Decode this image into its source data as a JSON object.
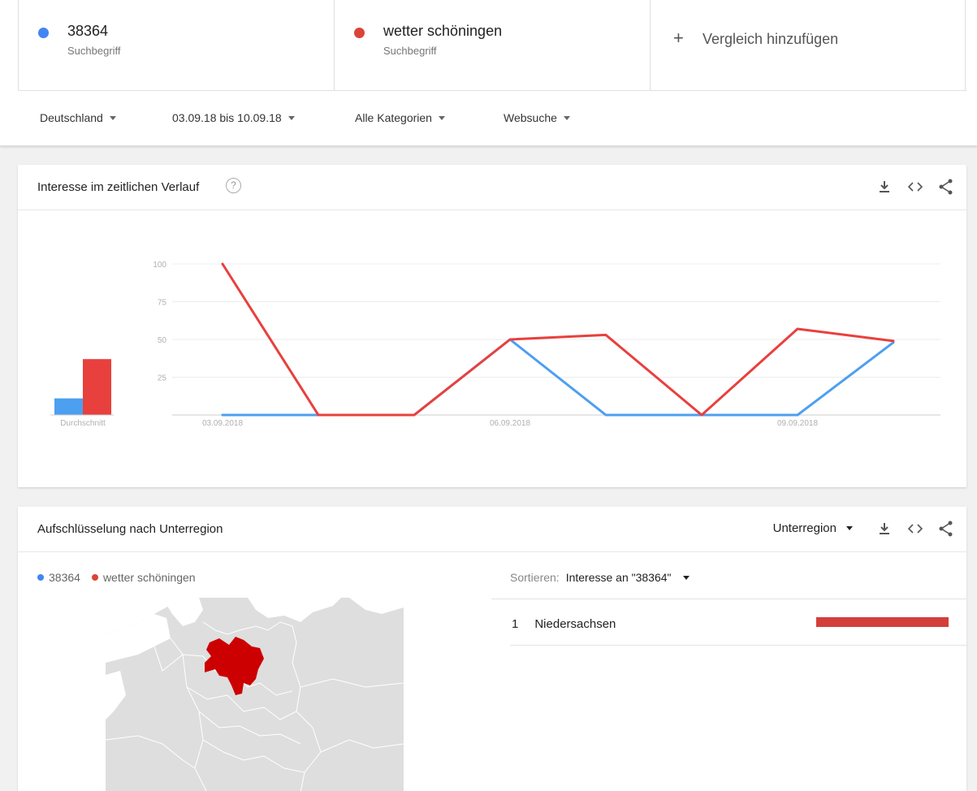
{
  "terms": [
    {
      "name": "38364",
      "type": "Suchbegriff",
      "color": "#4285f4"
    },
    {
      "name": "wetter schöningen",
      "type": "Suchbegriff",
      "color": "#db4437"
    }
  ],
  "add_compare": {
    "label": "Vergleich hinzufügen"
  },
  "filters": {
    "region": "Deutschland",
    "date": "03.09.18 bis 10.09.18",
    "category": "Alle Kategorien",
    "search_type": "Websuche"
  },
  "interest_card": {
    "title": "Interesse im zeitlichen Verlauf",
    "help": "?",
    "average_label": "Durchschnitt"
  },
  "breakdown_card": {
    "title": "Aufschlüsselung nach Unterregion",
    "resolution": "Unterregion",
    "legend": [
      "38364",
      "wetter schöningen"
    ],
    "sort_label": "Sortieren:",
    "sort_value": "Interesse an \"38364\"",
    "rows": [
      {
        "rank": "1",
        "region": "Niedersachsen",
        "value_fraction": 1.0
      }
    ]
  },
  "chart_data": [
    {
      "type": "line",
      "x": [
        "03.09.2018",
        "04.09.2018",
        "05.09.2018",
        "06.09.2018",
        "07.09.2018",
        "08.09.2018",
        "09.09.2018",
        "10.09.2018"
      ],
      "x_tick_labels": [
        "03.09.2018",
        "06.09.2018",
        "09.09.2018"
      ],
      "y_ticks": [
        25,
        50,
        75,
        100
      ],
      "ylim": [
        0,
        100
      ],
      "grid": true,
      "series": [
        {
          "name": "38364",
          "color": "#4d9ff0",
          "values": [
            0,
            0,
            0,
            50,
            0,
            0,
            0,
            48
          ]
        },
        {
          "name": "wetter schöningen",
          "color": "#e8403d",
          "values": [
            100,
            0,
            0,
            50,
            53,
            0,
            57,
            49
          ]
        }
      ]
    },
    {
      "type": "bar",
      "categories": [
        "Durchschnitt"
      ],
      "series": [
        {
          "name": "38364",
          "color": "#4d9ff0",
          "values": [
            11
          ]
        },
        {
          "name": "wetter schöningen",
          "color": "#e8403d",
          "values": [
            37
          ]
        }
      ],
      "ylim": [
        0,
        100
      ]
    }
  ]
}
